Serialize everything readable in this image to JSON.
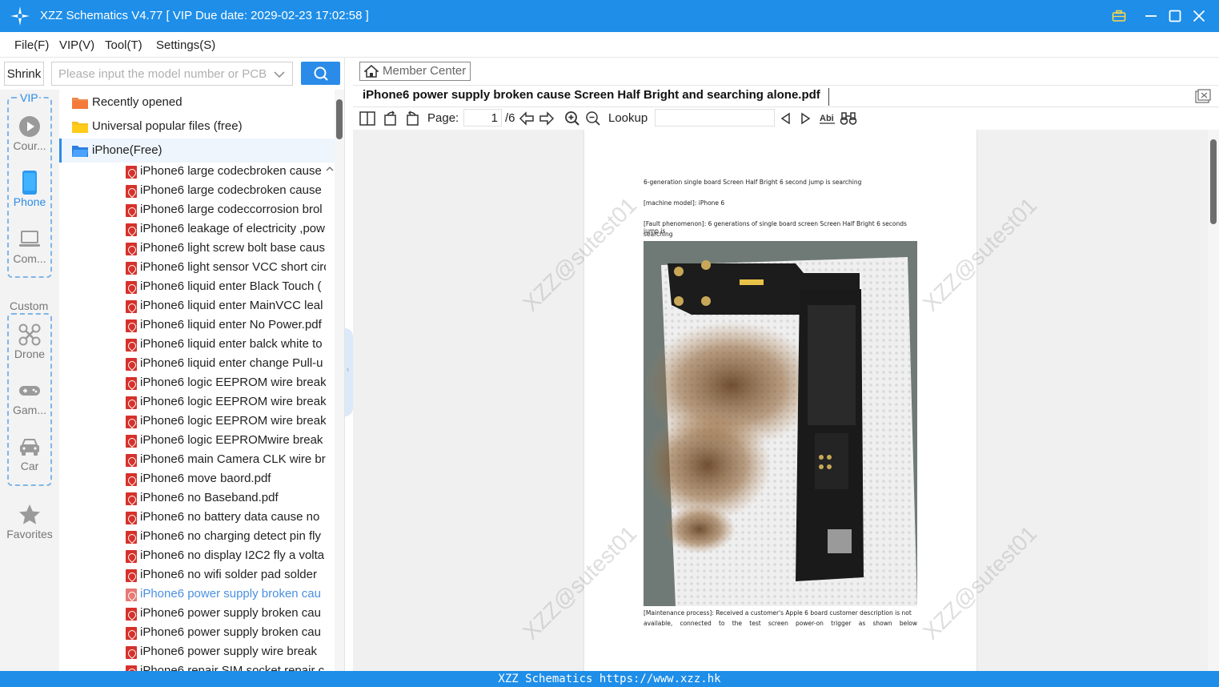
{
  "titlebar": {
    "title": "XZZ Schematics V4.77 [ VIP Due date: 2029-02-23 17:02:58 ]"
  },
  "menu": [
    "File(F)",
    "VIP(V)",
    "Tool(T)",
    "Settings(S)"
  ],
  "left_toolbar": {
    "shrink_label": "Shrink",
    "search_placeholder": "Please input the model number or PCB"
  },
  "categories": {
    "vip_group_label": "VIP",
    "custom_group_label": "Custom",
    "items": [
      {
        "label": "Cour...",
        "icon": "play-icon"
      },
      {
        "label": "Phone",
        "icon": "phone-icon",
        "active": true
      },
      {
        "label": "Com...",
        "icon": "laptop-icon"
      },
      {
        "label": "Drone",
        "icon": "drone-icon"
      },
      {
        "label": "Gam...",
        "icon": "gamepad-icon"
      },
      {
        "label": "Car",
        "icon": "car-icon"
      },
      {
        "label": "Favorites",
        "icon": "star-icon"
      }
    ]
  },
  "tree": {
    "folders": [
      {
        "label": "Recently opened",
        "icon": "folder-orange-icon"
      },
      {
        "label": "Universal popular files (free)",
        "icon": "folder-yellow-icon"
      },
      {
        "label": "iPhone(Free)",
        "icon": "folder-blue-icon"
      }
    ],
    "files": [
      "iPhone6 large codecbroken cause",
      "iPhone6 large codecbroken cause",
      "iPhone6 large codeccorrosion brol",
      "iPhone6 leakage of electricity ,pow",
      "iPhone6 light screw bolt base caus",
      "iPhone6 light sensor VCC short circ",
      "iPhone6 liquid enter Black Touch (",
      "iPhone6 liquid enter MainVCC leal",
      "iPhone6 liquid enter No Power.pdf",
      "iPhone6 liquid enter balck white to",
      "iPhone6 liquid enter change Pull-u",
      "iPhone6 logic EEPROM wire break",
      "iPhone6 logic EEPROM wire break",
      "iPhone6 logic EEPROM wire break",
      "iPhone6 logic EEPROMwire break",
      "iPhone6 main Camera CLK wire bre",
      "iPhone6 move baord.pdf",
      "iPhone6 no Baseband.pdf",
      "iPhone6 no battery data cause no",
      "iPhone6 no charging detect pin fly",
      "iPhone6 no display I2C2 fly a volta",
      "iPhone6 no wifi solder pad solder",
      "iPhone6 power supply broken cau",
      "iPhone6 power supply broken cau",
      "iPhone6 power supply broken cau",
      "iPhone6 power supply wire break",
      "iPhone6 repair SIM socket repair c"
    ],
    "current_index": 22
  },
  "right": {
    "member_center": "Member Center",
    "doc_tab": "iPhone6 power supply broken cause Screen Half Bright and searching alone.pdf",
    "toolbar": {
      "page_label": "Page:",
      "page_value": "1",
      "page_total": "/6",
      "lookup_label": "Lookup"
    },
    "document": {
      "lines": [
        "6-generation single board Screen Half Bright 6 second jump is searching",
        "[machine model]: iPhone 6",
        "[Fault phenomenon]: 6 generations of single board screen Screen Half Bright 6 seconds jump is",
        "searching",
        "[Maintenance process]: Received a customer's Apple 6 board customer description is not",
        "available, connected to the test screen power-on trigger as shown below"
      ],
      "watermark": "XZZ@sutest01"
    }
  },
  "statusbar": {
    "text": "XZZ Schematics https://www.xzz.hk"
  },
  "colors": {
    "accent": "#1e8ee8",
    "pdf_icon": "#d6312b",
    "current_file": "#4a90e2"
  }
}
